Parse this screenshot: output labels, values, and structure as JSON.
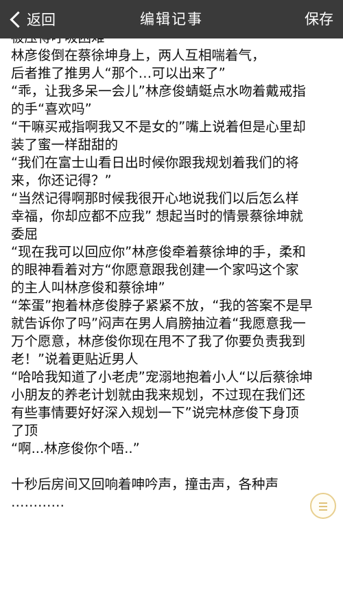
{
  "nav": {
    "back_label": "返回",
    "title": "编辑记事",
    "save_label": "保存"
  },
  "note": {
    "lines": [
      "被压得呼吸困难",
      "林彦俊倒在蔡徐坤身上，两人互相喘着气，",
      "后者推了推男人“那个…可以出来了”",
      "“乖，让我多呆一会儿”林彦俊蜻蜓点水吻着戴戒指",
      "的手“喜欢吗”",
      "“干嘛买戒指啊我又不是女的”嘴上说着但是心里却",
      "装了蜜一样甜甜的",
      "“我们在富士山看日出时候你跟我规划着我们的将",
      "来，你还记得？”",
      "“当然记得啊那时候我很开心地说我们以后怎么样",
      "幸福，你却应都不应我” 想起当时的情景蔡徐坤就",
      "委屈",
      "“现在我可以回应你”林彦俊牵着蔡徐坤的手，柔和",
      "的眼神看着对方“你愿意跟我创建一个家吗这个家",
      "的主人叫林彦俊和蔡徐坤”",
      "“笨蛋”抱着林彦俊脖子紧紧不放，“我的答案不是早",
      "就告诉你了吗”闷声在男人肩膀抽泣着“我愿意我一",
      "万个愿意，林彦俊你现在甩不了我了你要负责我到",
      "老！”说着更贴近男人",
      "“哈哈我知道了小老虎”宠溺地抱着小人“以后蔡徐坤",
      "小朋友的养老计划就由我来规划，不过现在我们还",
      "有些事情要好好深入规划一下”说完林彦俊下身顶",
      "了顶",
      "“啊...林彦俊你个唔..”",
      "",
      "十秒后房间又回响着呻吟声，撞击声，各种声",
      "…………"
    ]
  }
}
